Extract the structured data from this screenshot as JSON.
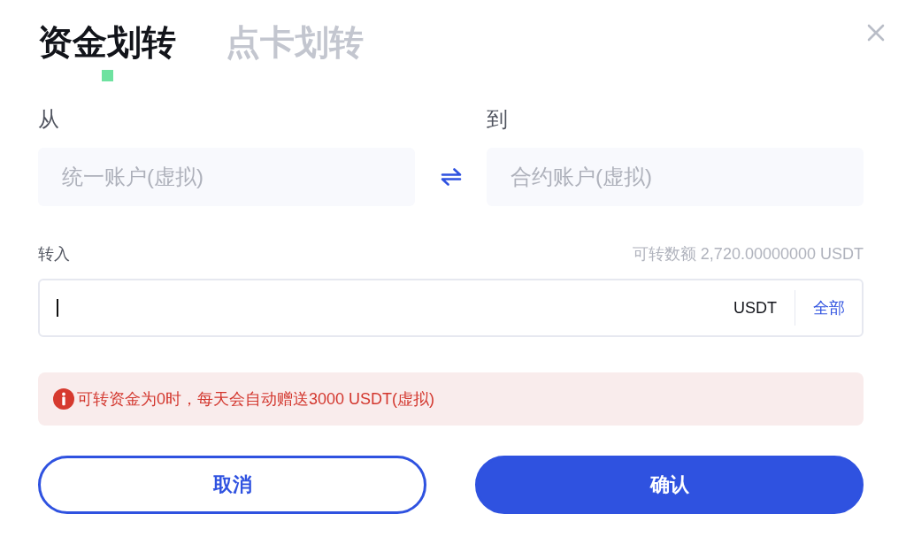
{
  "tabs": [
    {
      "label": "资金划转",
      "selected": true
    },
    {
      "label": "点卡划转",
      "selected": false
    }
  ],
  "transfer": {
    "from": {
      "label": "从",
      "account": "统一账户(虚拟)"
    },
    "to": {
      "label": "到",
      "account": "合约账户(虚拟)"
    }
  },
  "amount": {
    "label": "转入",
    "available": "可转数额 2,720.00000000 USDT",
    "focused": true,
    "currency": "USDT",
    "all_button": "全部"
  },
  "notice": "可转资金为0时，每天会自动赠送3000 USDT(虚拟)",
  "buttons": [
    {
      "label": "取消",
      "kind": "outline"
    },
    {
      "label": "确认",
      "kind": "primary"
    }
  ]
}
